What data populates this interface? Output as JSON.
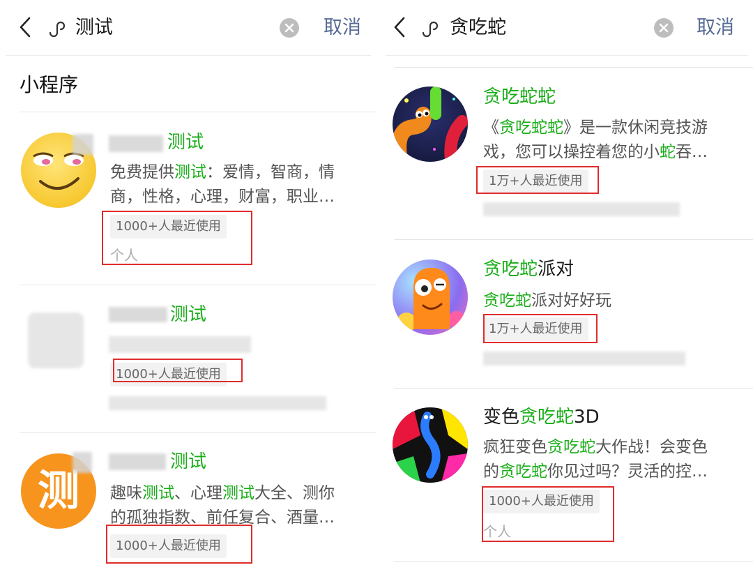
{
  "left": {
    "header": {
      "query": "测试",
      "cancel_label": "取消"
    },
    "section_title": "小程序",
    "results": [
      {
        "name_suffix": "测试",
        "desc_lines": [
          [
            {
              "t": "免费提供",
              "h": false
            },
            {
              "t": "测试",
              "h": true
            },
            {
              "t": "：爱情，智商，情",
              "h": false
            }
          ],
          [
            {
              "t": "商，性格，心理，财富，职业…",
              "h": false
            }
          ]
        ],
        "badge": "1000+人最近使用",
        "owner": "个人"
      },
      {
        "name_suffix": "测试",
        "desc_lines": [],
        "badge": "1000+人最近使用",
        "owner": ""
      },
      {
        "avatar_text": "测",
        "name_suffix": "测试",
        "desc_lines": [
          [
            {
              "t": "趣味",
              "h": false
            },
            {
              "t": "测试",
              "h": true
            },
            {
              "t": "、心理",
              "h": false
            },
            {
              "t": "测试",
              "h": true
            },
            {
              "t": "大全、测你",
              "h": false
            }
          ],
          [
            {
              "t": "的孤独指数、前任复合、酒量…",
              "h": false
            }
          ]
        ],
        "badge": "1000+人最近使用",
        "owner": ""
      }
    ]
  },
  "right": {
    "header": {
      "query": "贪吃蛇",
      "cancel_label": "取消"
    },
    "results": [
      {
        "name_parts": [
          {
            "t": "贪吃蛇蛇",
            "h": true
          }
        ],
        "desc_lines": [
          [
            {
              "t": "《",
              "h": false
            },
            {
              "t": "贪吃蛇蛇",
              "h": true
            },
            {
              "t": "》是一款休闲竞技游",
              "h": false
            }
          ],
          [
            {
              "t": "戏，您可以操控着您的小",
              "h": false
            },
            {
              "t": "蛇",
              "h": true
            },
            {
              "t": "吞…",
              "h": false
            }
          ]
        ],
        "badge": "1万+人最近使用",
        "owner": ""
      },
      {
        "name_parts": [
          {
            "t": "贪吃蛇",
            "h": true
          },
          {
            "t": "派对",
            "h": false
          }
        ],
        "desc_lines": [
          [
            {
              "t": "贪吃蛇",
              "h": true
            },
            {
              "t": "派对好好玩",
              "h": false
            }
          ]
        ],
        "badge": "1万+人最近使用",
        "owner": ""
      },
      {
        "name_parts": [
          {
            "t": "变色",
            "h": false
          },
          {
            "t": "贪吃蛇",
            "h": true
          },
          {
            "t": "3D",
            "h": false
          }
        ],
        "desc_lines": [
          [
            {
              "t": "疯狂变色",
              "h": false
            },
            {
              "t": "贪吃蛇",
              "h": true
            },
            {
              "t": "大作战！会变色",
              "h": false
            }
          ],
          [
            {
              "t": "的",
              "h": false
            },
            {
              "t": "贪吃蛇",
              "h": true
            },
            {
              "t": "你见过吗？灵活的控…",
              "h": false
            }
          ]
        ],
        "badge": "1000+人最近使用",
        "owner": "个人"
      }
    ]
  },
  "colors": {
    "highlight": "#1aad19",
    "cancel": "#576b95",
    "annotation": "#e02c2c"
  },
  "icons": {
    "back": "chevron-left-icon",
    "mini_program": "mini-program-link-icon",
    "clear": "clear-circle-icon"
  }
}
